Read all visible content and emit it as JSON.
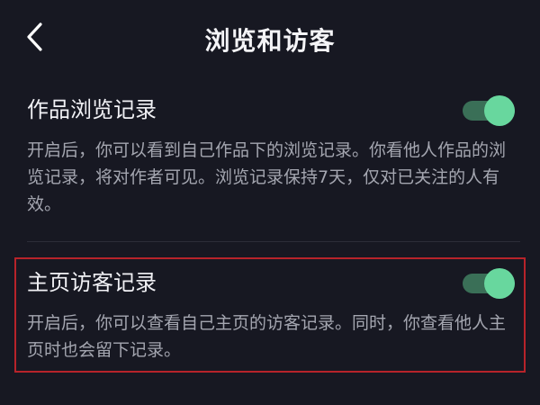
{
  "header": {
    "title": "浏览和访客",
    "back_icon": "chevron-left-icon"
  },
  "sections": [
    {
      "title": "作品浏览记录",
      "toggle_on": true,
      "description": "开启后，你可以看到自己作品下的浏览记录。你看他人作品的浏览记录，将对作者可见。浏览记录保持7天，仅对已关注的人有效。"
    },
    {
      "title": "主页访客记录",
      "toggle_on": true,
      "description": "开启后，你可以查看自己主页的访客记录。同时，你查看他人主页时也会留下记录。"
    }
  ],
  "colors": {
    "background": "#171822",
    "toggle_track": "#3a6f57",
    "toggle_knob": "#68d79e",
    "highlight_border": "#b7232a"
  }
}
